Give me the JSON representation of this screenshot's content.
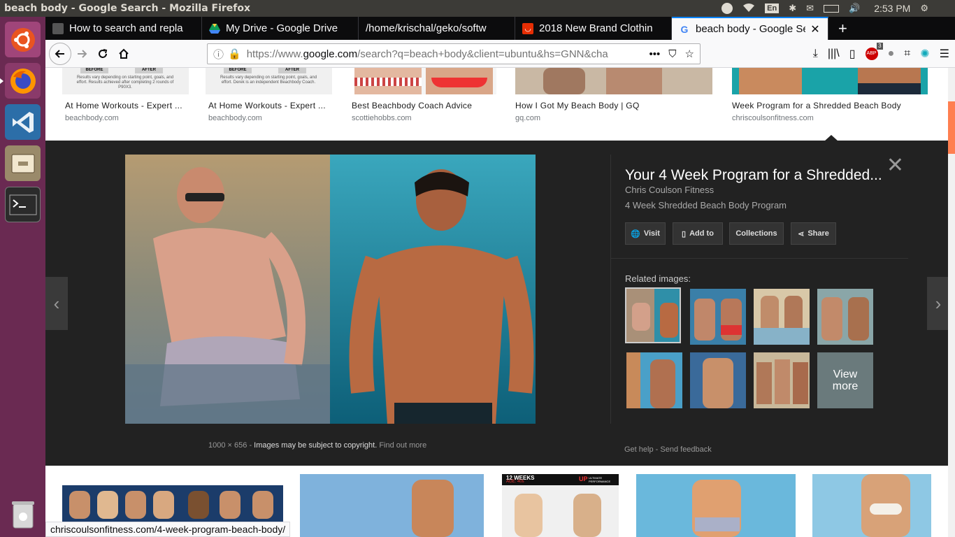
{
  "window": {
    "title": "beach body - Google Search - Mozilla Firefox",
    "tray": {
      "lang": "En",
      "clock": "2:53 PM"
    }
  },
  "launcher": {
    "items": [
      "ubuntu-dash-icon",
      "firefox-icon",
      "vscode-icon",
      "files-icon",
      "terminal-icon",
      "trash-icon"
    ]
  },
  "tabs": [
    {
      "label": "How to search and repla",
      "icon": "tab-favicon"
    },
    {
      "label": "My Drive - Google Drive",
      "icon": "drive-icon"
    },
    {
      "label": "/home/krischal/geko/softw",
      "icon": "none"
    },
    {
      "label": "2018 New Brand Clothin",
      "icon": "shop-icon"
    },
    {
      "label": "beach body - Google Sea",
      "icon": "google-icon",
      "active": true
    }
  ],
  "navbar": {
    "url_prefix": "https://www.",
    "url_domain": "google.com",
    "url_rest": "/search?q=beach+body&client=ubuntu&hs=GNN&cha",
    "abp_badge": "3"
  },
  "results_top": [
    {
      "title": "At Home Workouts - Expert ...",
      "source": "beachbody.com"
    },
    {
      "title": "At Home Workouts - Expert ...",
      "source": "beachbody.com"
    },
    {
      "title": "Best Beachbody Coach Advice",
      "source": "scottiehobbs.com"
    },
    {
      "title": "How I Got My Beach Body | GQ",
      "source": "gq.com"
    },
    {
      "title": "Week Program for a Shredded Beach Body",
      "source": "chriscoulsonfitness.com"
    }
  ],
  "thumb_text": {
    "before": "BEFORE",
    "after": "AFTER",
    "note1": "Results vary depending on starting point, goals, and effort. Results achieved after completing 2 rounds of P90X3.",
    "note2": "Results vary depending on starting point, goals, and effort. Derek is an independent Beachbody Coach."
  },
  "viewer": {
    "title": "Your 4 Week Program for a Shredded...",
    "site": "Chris Coulson Fitness",
    "desc": "4 Week Shredded Beach Body Program",
    "buttons": {
      "visit": "Visit",
      "add_to": "Add to",
      "collections": "Collections",
      "share": "Share"
    },
    "related_heading": "Related images:",
    "view_more": "View more",
    "dimensions": "1000 × 656",
    "copyright": "Images may be subject to copyright.",
    "find_out_more": "Find out more",
    "get_help": "Get help",
    "send_feedback": "Send feedback",
    "sep": "-"
  },
  "bottom_badges": {
    "weeks": "12 WEEKS",
    "age": "AGE: 40s",
    "up": "UP",
    "up_sub": "ULTIMATE PERFORMANCE"
  },
  "status_url": "chriscoulsonfitness.com/4-week-program-beach-body/"
}
